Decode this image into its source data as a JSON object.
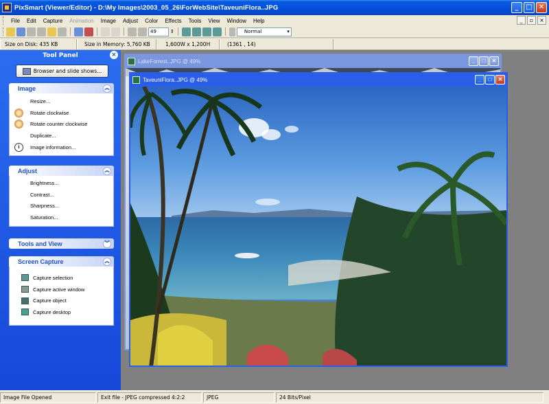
{
  "window": {
    "title": "PixSmart (Viewer/Editor) - D:\\My Images\\2003_05_26\\ForWebSite\\TaveuniFlora..JPG",
    "minimize": "_",
    "maximize": "□",
    "close": "✕"
  },
  "menu": {
    "items": [
      {
        "label": "File",
        "enabled": true
      },
      {
        "label": "Edit",
        "enabled": true
      },
      {
        "label": "Capture",
        "enabled": true
      },
      {
        "label": "Animation",
        "enabled": false
      },
      {
        "label": "Image",
        "enabled": true
      },
      {
        "label": "Adjust",
        "enabled": true
      },
      {
        "label": "Color",
        "enabled": true
      },
      {
        "label": "Effects",
        "enabled": true
      },
      {
        "label": "Tools",
        "enabled": true
      },
      {
        "label": "View",
        "enabled": true
      },
      {
        "label": "Window",
        "enabled": true
      },
      {
        "label": "Help",
        "enabled": true
      }
    ]
  },
  "toolbar": {
    "zoom_value": "49",
    "mode_value": "Normal"
  },
  "infobar": {
    "size_on_disk": "Size on Disk: 435 KB",
    "size_in_memory": "Size in Memory: 5,760 KB",
    "dimensions": "1,600W x 1,200H",
    "coordinates": "(1361 , 14)"
  },
  "tool_panel": {
    "title": "Tool Panel",
    "close": "×",
    "browser_button": "Browser and slide shows...",
    "groups": {
      "image": {
        "title": "Image",
        "toggle": "︽",
        "items": [
          "Resize...",
          "Rotate clockwise",
          "Rotate counter clockwise",
          "Duplicate...",
          "Image information..."
        ]
      },
      "adjust": {
        "title": "Adjust",
        "toggle": "︽",
        "items": [
          "Brightness...",
          "Contrast...",
          "Sharpness...",
          "Saturation..."
        ]
      },
      "tools_view": {
        "title": "Tools and View",
        "toggle": "︾"
      },
      "screen_capture": {
        "title": "Screen Capture",
        "toggle": "︽",
        "items": [
          "Capture selection",
          "Capture active window",
          "Capture object",
          "Capture desktop"
        ]
      }
    }
  },
  "documents": {
    "back": {
      "title": "LakeForrest..JPG @ 49%"
    },
    "front": {
      "title": "TaveuniFlora..JPG @ 49%"
    }
  },
  "statusbar": {
    "status": "Image File Opened",
    "file_info": "Exit file - JPEG compressed 4:2:2",
    "format": "JPEG",
    "bits": "24 Bits/Pixel"
  },
  "colors": {
    "title_blue": "#0550dc",
    "panel_blue": "#1e5ce6",
    "group_header_text": "#2151c0",
    "mdi_background": "#808080"
  }
}
